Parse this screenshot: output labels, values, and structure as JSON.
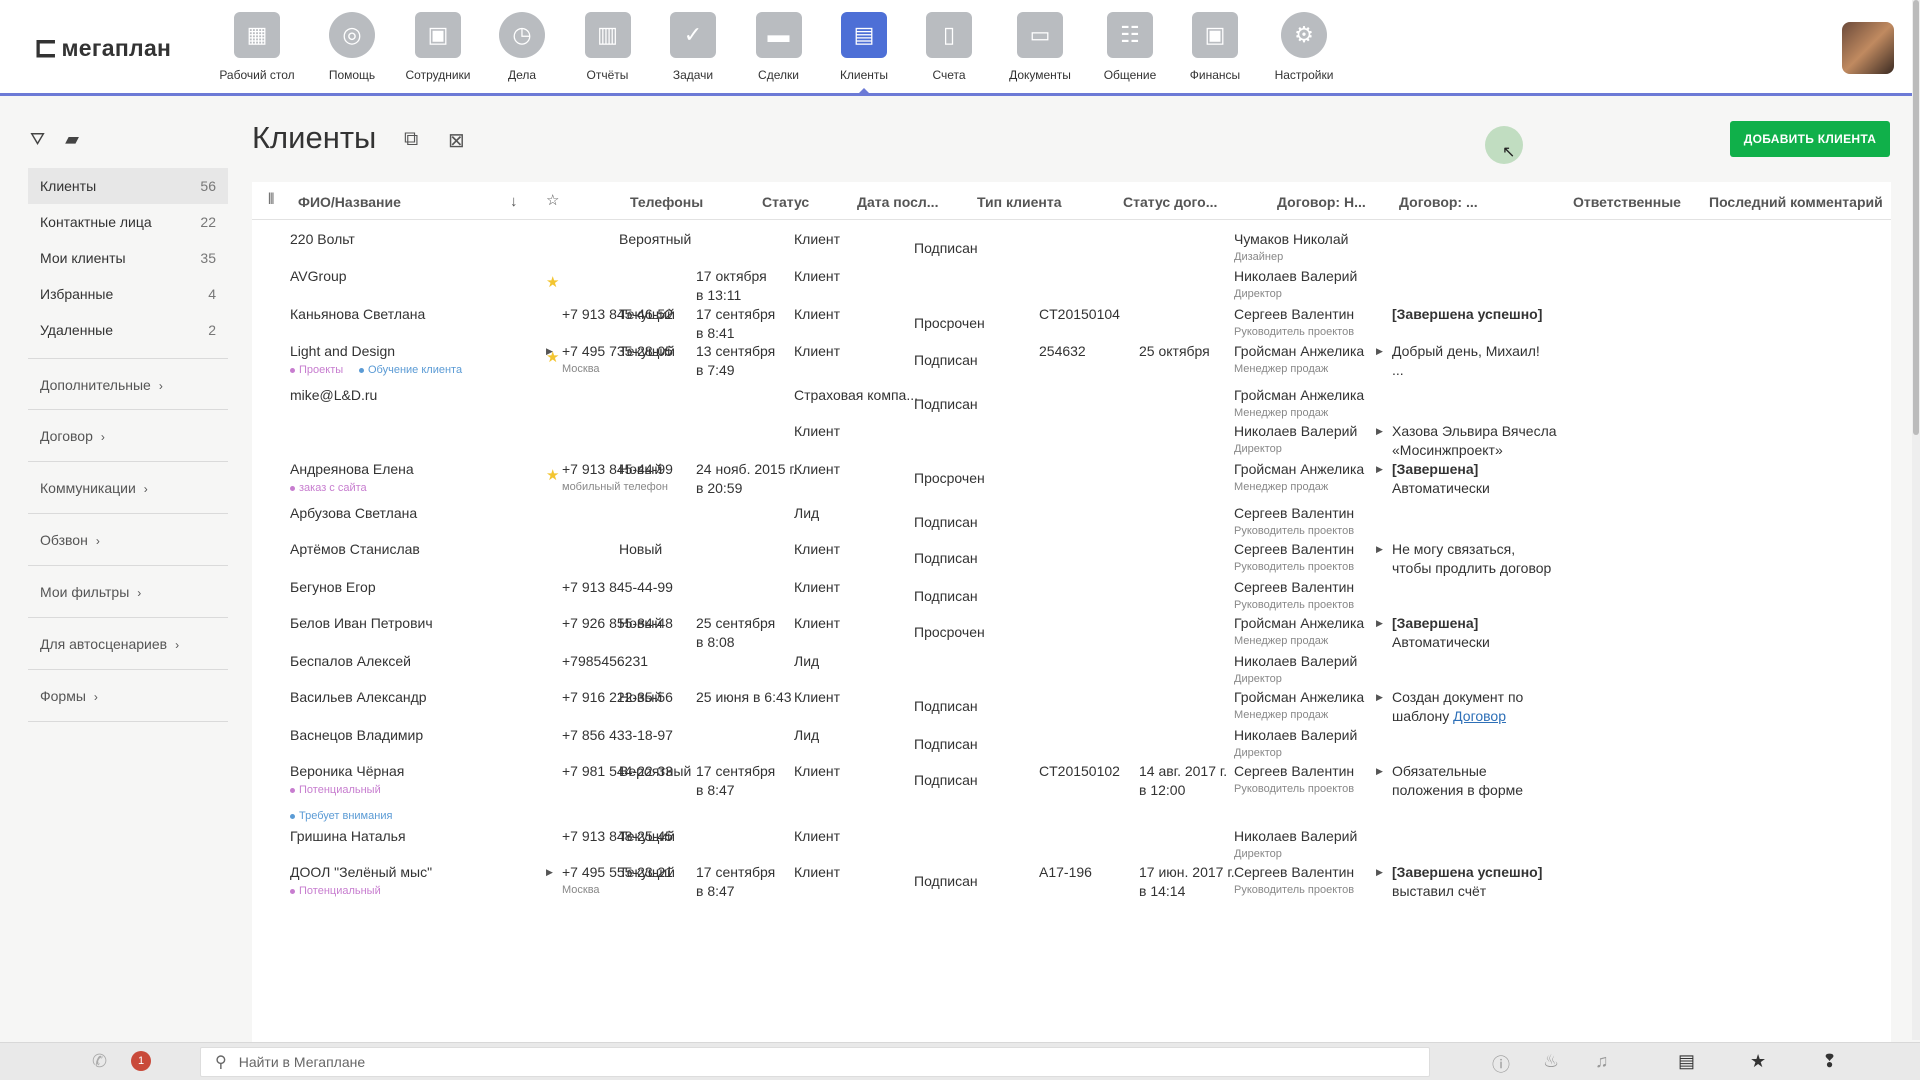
{
  "app": {
    "logo_text": "мегаплан",
    "nav": [
      {
        "label": "Рабочий стол",
        "icon": "desktop-icon",
        "glyph": "▦"
      },
      {
        "label": "Помощь",
        "icon": "lifebuoy-icon",
        "glyph": "◎"
      },
      {
        "label": "Сотрудники",
        "icon": "employees-icon",
        "glyph": "▣"
      },
      {
        "label": "Дела",
        "icon": "clock-icon",
        "glyph": "◷"
      },
      {
        "label": "Отчёты",
        "icon": "reports-icon",
        "glyph": "▥"
      },
      {
        "label": "Задачи",
        "icon": "tasks-icon",
        "glyph": "✓"
      },
      {
        "label": "Сделки",
        "icon": "briefcase-icon",
        "glyph": "▬"
      },
      {
        "label": "Клиенты",
        "icon": "clients-icon",
        "glyph": "▤"
      },
      {
        "label": "Счета",
        "icon": "invoice-icon",
        "glyph": "▯"
      },
      {
        "label": "Документы",
        "icon": "folder-icon",
        "glyph": "▭"
      },
      {
        "label": "Общение",
        "icon": "chat-icon",
        "glyph": "☷"
      },
      {
        "label": "Финансы",
        "icon": "safe-icon",
        "glyph": "▣"
      },
      {
        "label": "Настройки",
        "icon": "gear-icon",
        "glyph": "⚙"
      }
    ],
    "active_nav": "Клиенты",
    "accent_color": "#6c7ad6",
    "add_button_color": "#10b04a"
  },
  "sidebar": {
    "items": [
      {
        "label": "Клиенты",
        "count": "56",
        "active": true
      },
      {
        "label": "Контактные лица",
        "count": "22"
      },
      {
        "label": "Мои клиенты",
        "count": "35"
      },
      {
        "label": "Избранные",
        "count": "4"
      },
      {
        "label": "Удаленные",
        "count": "2"
      }
    ],
    "groups": [
      {
        "label": "Дополнительные"
      },
      {
        "label": "Договор"
      },
      {
        "label": "Коммуникации"
      },
      {
        "label": "Обзвон"
      },
      {
        "label": "Мои фильтры"
      },
      {
        "label": "Для автосценариев"
      },
      {
        "label": "Формы"
      }
    ]
  },
  "main": {
    "title": "Клиенты",
    "add_button": "ДОБАВИТЬ КЛИЕНТА",
    "columns": {
      "name": "ФИО/Название",
      "phones": "Телефоны",
      "status": "Статус",
      "date": "Дата посл...",
      "type": "Тип клиента",
      "contract_status": "Статус дого...",
      "contract_no": "Договор: Н...",
      "contract_date": "Договор: ...",
      "responsible": "Ответственные",
      "comment": "Последний комментарий"
    },
    "rows": [
      {
        "name": "220 Вольт",
        "status": "Вероятный",
        "type": "Клиент",
        "contract_status": "Подписан",
        "resp": "Чумаков Николай",
        "resp_role": "Дизайнер"
      },
      {
        "name": "AVGroup",
        "star": true,
        "date": "17 октября",
        "date2": "в 13:11",
        "type": "Клиент",
        "resp": "Николаев Валерий",
        "resp_role": "Директор"
      },
      {
        "name": "Каньянова Светлана",
        "phone": "+7 913 845-46-52",
        "status": "Текущий",
        "date": "17 сентября",
        "date2": "в 8:41",
        "type": "Клиент",
        "contract_status": "Просрочен",
        "contract_no": "CT20150104",
        "resp": "Сергеев Валентин",
        "resp_role": "Руководитель проектов",
        "comment": "[Завершена успешно]",
        "comment_bold": true
      },
      {
        "name": "Light and Design",
        "tags": [
          {
            "t": "Проекты",
            "c": "pink"
          },
          {
            "t": "Обучение клиента",
            "c": "blue"
          }
        ],
        "star": true,
        "phone_tri": true,
        "phone": "+7 495 735-28-05",
        "phone_sub": "Москва",
        "status": "Текущий",
        "date": "13 сентября",
        "date2": "в 7:49",
        "type": "Клиент",
        "contract_status": "Подписан",
        "contract_no": "254632",
        "contract_date": "25 октября",
        "resp": "Гройсман Анжелика",
        "resp_role": "Менеджер продаж",
        "comment_tri": true,
        "comment": "Добрый день, Михаил!",
        "comment2": "..."
      },
      {
        "name": "mike@L&D.ru",
        "type": "Страховая компа...",
        "contract_status": "Подписан",
        "resp": "Гройсман Анжелика",
        "resp_role": "Менеджер продаж"
      },
      {
        "name": "",
        "type": "Клиент",
        "resp": "Николаев Валерий",
        "resp_role": "Директор",
        "comment_tri": true,
        "comment": "Хазова Эльвира Вячесла",
        "comment2": "«Мосинжпроект»"
      },
      {
        "name": "Андреянова Елена",
        "tags": [
          {
            "t": "заказ с сайта",
            "c": "pink"
          }
        ],
        "star": true,
        "phone": "+7 913 845-44-99",
        "phone_sub": "мобильный телефон",
        "status": "Новый",
        "date": "24 нояб. 2015 г.",
        "date2": "в 20:59",
        "type": "Клиент",
        "contract_status": "Просрочен",
        "resp": "Гройсман Анжелика",
        "resp_role": "Менеджер продаж",
        "comment_tri": true,
        "comment": "[Завершена]",
        "comment_bold": true,
        "comment2": "Автоматически"
      },
      {
        "name": "Арбузова Светлана",
        "type": "Лид",
        "contract_status": "Подписан",
        "resp": "Сергеев Валентин",
        "resp_role": "Руководитель проектов"
      },
      {
        "name": "Артёмов Станислав",
        "status": "Новый",
        "type": "Клиент",
        "contract_status": "Подписан",
        "resp": "Сергеев Валентин",
        "resp_role": "Руководитель проектов",
        "comment_tri": true,
        "comment": "Не могу связаться,",
        "comment2": "чтобы продлить договор"
      },
      {
        "name": "Бегунов Егор",
        "phone": "+7 913 845-44-99",
        "type": "Клиент",
        "contract_status": "Подписан",
        "resp": "Сергеев Валентин",
        "resp_role": "Руководитель проектов"
      },
      {
        "name": "Белов Иван Петрович",
        "phone": "+7 926 855-84-48",
        "status": "Новый",
        "date": "25 сентября",
        "date2": "в 8:08",
        "type": "Клиент",
        "contract_status": "Просрочен",
        "resp": "Гройсман Анжелика",
        "resp_role": "Менеджер продаж",
        "comment_tri": true,
        "comment": "[Завершена]",
        "comment_bold": true,
        "comment2": "Автоматически"
      },
      {
        "name": "Беспалов Алексей",
        "phone": "+7985456231",
        "type": "Лид",
        "resp": "Николаев Валерий",
        "resp_role": "Директор"
      },
      {
        "name": "Васильев Александр",
        "phone": "+7 916 222-35-56",
        "status": "Новый",
        "date": "25 июня в 6:43",
        "type": "Клиент",
        "contract_status": "Подписан",
        "resp": "Гройсман Анжелика",
        "resp_role": "Менеджер продаж",
        "comment_tri": true,
        "comment": "Создан документ по",
        "comment2": "шаблону ",
        "comment_link": "Договор"
      },
      {
        "name": "Васнецов Владимир",
        "phone": "+7 856 433-18-97",
        "type": "Лид",
        "contract_status": "Подписан",
        "resp": "Николаев Валерий",
        "resp_role": "Директор"
      },
      {
        "name": "Вероника Чёрная",
        "tags": [
          {
            "t": "Потенциальный",
            "c": "pink"
          },
          {
            "t": "Требует внимания",
            "c": "blue"
          }
        ],
        "phone": "+7 981 544-22-33",
        "status": "Вероятный",
        "date": "17 сентября",
        "date2": "в 8:47",
        "type": "Клиент",
        "contract_status": "Подписан",
        "contract_no": "CT20150102",
        "contract_date": "14 авг. 2017 г.",
        "contract_date2": "в 12:00",
        "resp": "Сергеев Валентин",
        "resp_role": "Руководитель проектов",
        "comment_tri": true,
        "comment": "Обязательные",
        "comment2": "положения в форме"
      },
      {
        "name": "Гришина Наталья",
        "phone": "+7 913 848-25-45",
        "status": "Текущий",
        "type": "Клиент",
        "resp": "Николаев Валерий",
        "resp_role": "Директор"
      },
      {
        "name": "ДООЛ \"Зелёный мыс\"",
        "tags": [
          {
            "t": "Потенциальный",
            "c": "pink"
          }
        ],
        "phone_tri": true,
        "phone": "+7 495 555-23-21",
        "phone_sub": "Москва",
        "status": "Текущий",
        "date": "17 сентября",
        "date2": "в 8:47",
        "type": "Клиент",
        "contract_status": "Подписан",
        "contract_no": "A17-196",
        "contract_date": "17 июн. 2017 г.",
        "contract_date2": "в 14:14",
        "resp": "Сергеев Валентин",
        "resp_role": "Руководитель проектов",
        "comment_tri": true,
        "comment": "[Завершена успешно]",
        "comment_bold": true,
        "comment2": "выставил счёт"
      }
    ]
  },
  "bottombar": {
    "badge": "1",
    "search_placeholder": "Найти в Мегаплане"
  }
}
